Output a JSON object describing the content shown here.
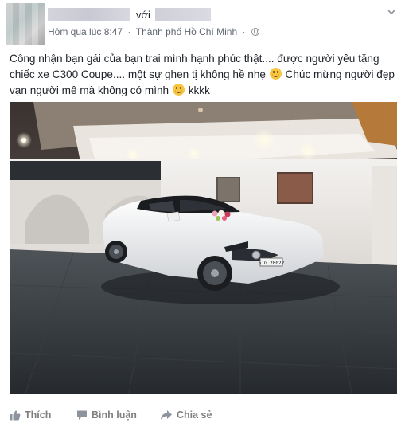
{
  "post": {
    "with_word": "với",
    "timestamp": "Hôm qua lúc 8:47",
    "separator": "·",
    "location": "Thành phố Hồ Chí Minh",
    "meta_separator": "·",
    "privacy_icon": "globe-icon",
    "text_part1": "Công nhận bạn gái của bạn trai mình hạnh phúc thật.... được người yêu tặng chiếc xe C300 Coupe.... một sự ghen tị không hề nhẹ",
    "text_part2": "Chúc mừng người đẹp vạn người mê mà không có mình",
    "text_part3": "kkkk",
    "photo": {
      "description_icon": "photo-of-white-car-in-garage",
      "plate_text": "51G 20022"
    }
  },
  "actions": {
    "like_label": "Thích",
    "comment_label": "Bình luận",
    "share_label": "Chia sẻ"
  },
  "colors": {
    "text": "#1d2129",
    "meta": "#616770",
    "action": "#7f7f7f",
    "emoji": "#f7c542"
  }
}
